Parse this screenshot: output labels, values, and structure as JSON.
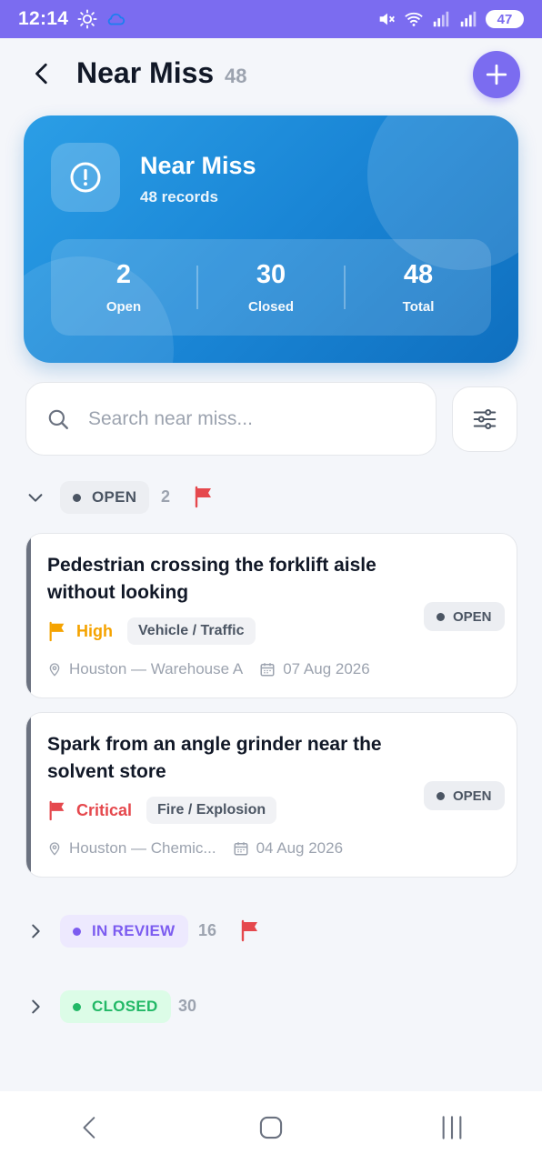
{
  "status_bar": {
    "time": "12:14",
    "battery": "47"
  },
  "header": {
    "title": "Near Miss",
    "count": "48"
  },
  "hero": {
    "title": "Near Miss",
    "subtitle": "48 records",
    "stats": [
      {
        "value": "2",
        "label": "Open"
      },
      {
        "value": "30",
        "label": "Closed"
      },
      {
        "value": "48",
        "label": "Total"
      }
    ]
  },
  "search": {
    "placeholder": "Search near miss..."
  },
  "groups": {
    "open": {
      "label": "OPEN",
      "count": "2",
      "expanded": true,
      "flagged": true
    },
    "in_review": {
      "label": "IN REVIEW",
      "count": "16",
      "expanded": false,
      "flagged": true
    },
    "closed": {
      "label": "CLOSED",
      "count": "30",
      "expanded": false,
      "flagged": false
    }
  },
  "cards": [
    {
      "title": "Pedestrian crossing the forklift aisle without looking",
      "severity": "High",
      "category": "Vehicle / Traffic",
      "location": "Houston — Warehouse A",
      "date": "07 Aug 2026",
      "status": "OPEN"
    },
    {
      "title": "Spark from an angle grinder near the solvent store",
      "severity": "Critical",
      "category": "Fire / Explosion",
      "location": "Houston — Chemic...",
      "date": "04 Aug 2026",
      "status": "OPEN"
    }
  ],
  "colors": {
    "accent": "#7b6cf0",
    "hero": "#1a86d6",
    "high": "#f5a300",
    "critical": "#e5484d",
    "review": "#7c5cf0",
    "closed": "#22b866"
  },
  "icons": [
    "sun-icon",
    "cloud-icon",
    "mute-icon",
    "wifi-icon",
    "signal-icon",
    "back-arrow-icon",
    "plus-icon",
    "alert-circle-icon",
    "search-icon",
    "filter-sliders-icon",
    "chevron-down-icon",
    "chevron-right-icon",
    "flag-icon",
    "location-pin-icon",
    "calendar-icon",
    "nav-back-icon",
    "nav-home-icon",
    "nav-recents-icon"
  ]
}
